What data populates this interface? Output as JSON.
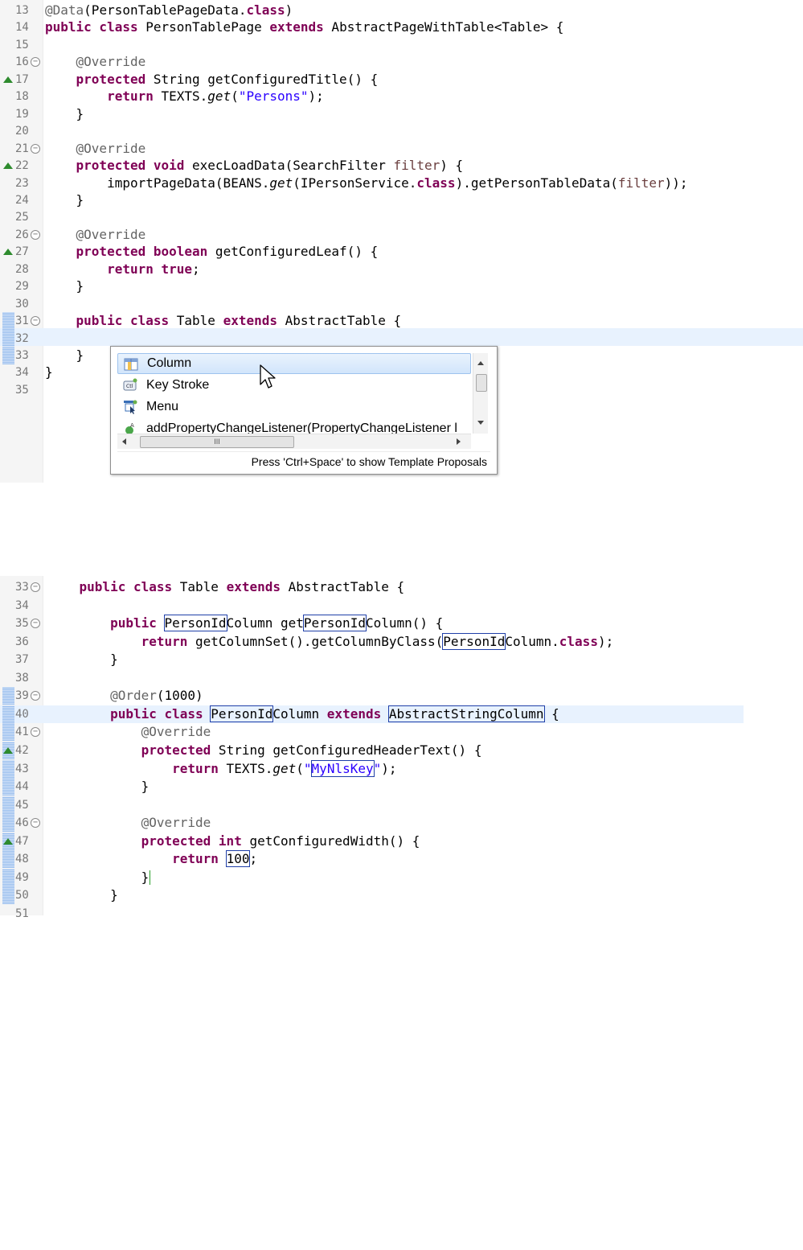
{
  "editor1": {
    "lines": [
      {
        "num": "13",
        "tokens": [
          [
            "an",
            "@Data"
          ],
          [
            "",
            "(PersonTablePageData."
          ],
          [
            "kw",
            "class"
          ],
          [
            "",
            ")"
          ]
        ]
      },
      {
        "num": "14",
        "tokens": [
          [
            "kw",
            "public class"
          ],
          [
            "",
            " PersonTablePage "
          ],
          [
            "kw",
            "extends"
          ],
          [
            "",
            " AbstractPageWithTable<Table> {"
          ]
        ]
      },
      {
        "num": "15",
        "tokens": []
      },
      {
        "num": "16",
        "tokens": [
          [
            "",
            "    "
          ],
          [
            "an",
            "@Override"
          ]
        ]
      },
      {
        "num": "17",
        "tokens": [
          [
            "",
            "    "
          ],
          [
            "kw",
            "protected"
          ],
          [
            "",
            " String getConfiguredTitle() {"
          ]
        ]
      },
      {
        "num": "18",
        "tokens": [
          [
            "",
            "        "
          ],
          [
            "kw",
            "return"
          ],
          [
            "",
            " TEXTS."
          ],
          [
            "it",
            "get"
          ],
          [
            "",
            "("
          ],
          [
            "str",
            "\"Persons\""
          ],
          [
            "",
            ");"
          ]
        ]
      },
      {
        "num": "19",
        "tokens": [
          [
            "",
            "    }"
          ]
        ]
      },
      {
        "num": "20",
        "tokens": []
      },
      {
        "num": "21",
        "tokens": [
          [
            "",
            "    "
          ],
          [
            "an",
            "@Override"
          ]
        ]
      },
      {
        "num": "22",
        "tokens": [
          [
            "",
            "    "
          ],
          [
            "kw",
            "protected void"
          ],
          [
            "",
            " execLoadData(SearchFilter "
          ],
          [
            "param",
            "filter"
          ],
          [
            "",
            ") {"
          ]
        ]
      },
      {
        "num": "23",
        "tokens": [
          [
            "",
            "        importPageData(BEANS."
          ],
          [
            "it",
            "get"
          ],
          [
            "",
            "(IPersonService."
          ],
          [
            "kw",
            "class"
          ],
          [
            "",
            ").getPersonTableData("
          ],
          [
            "param",
            "filter"
          ],
          [
            "",
            "));"
          ]
        ]
      },
      {
        "num": "24",
        "tokens": [
          [
            "",
            "    }"
          ]
        ]
      },
      {
        "num": "25",
        "tokens": []
      },
      {
        "num": "26",
        "tokens": [
          [
            "",
            "    "
          ],
          [
            "an",
            "@Override"
          ]
        ]
      },
      {
        "num": "27",
        "tokens": [
          [
            "",
            "    "
          ],
          [
            "kw",
            "protected boolean"
          ],
          [
            "",
            " getConfiguredLeaf() {"
          ]
        ]
      },
      {
        "num": "28",
        "tokens": [
          [
            "",
            "        "
          ],
          [
            "kw",
            "return true"
          ],
          [
            "",
            ";"
          ]
        ]
      },
      {
        "num": "29",
        "tokens": [
          [
            "",
            "    }"
          ]
        ]
      },
      {
        "num": "30",
        "tokens": []
      },
      {
        "num": "31",
        "tokens": [
          [
            "",
            "    "
          ],
          [
            "kw",
            "public class"
          ],
          [
            "",
            " Table "
          ],
          [
            "kw",
            "extends"
          ],
          [
            "",
            " AbstractTable {"
          ]
        ]
      },
      {
        "num": "32",
        "tokens": []
      },
      {
        "num": "33",
        "tokens": [
          [
            "",
            "    }"
          ]
        ]
      },
      {
        "num": "34",
        "tokens": [
          [
            "",
            "}"
          ]
        ]
      },
      {
        "num": "35",
        "tokens": []
      }
    ]
  },
  "popup": {
    "items": [
      {
        "label": "Column",
        "icon": "column-icon"
      },
      {
        "label": "Key Stroke",
        "icon": "key-stroke-icon"
      },
      {
        "label": "Menu",
        "icon": "menu-icon"
      },
      {
        "label": "addPropertyChangeListener(PropertyChangeListener l",
        "icon": "method-icon"
      }
    ],
    "hscroll_grip": "III",
    "status": "Press 'Ctrl+Space' to show Template Proposals"
  },
  "editor2": {
    "lines": [
      {
        "num": "33",
        "tokens": [
          [
            "",
            "    "
          ],
          [
            "kw",
            "public class"
          ],
          [
            "",
            " Table "
          ],
          [
            "kw",
            "extends"
          ],
          [
            "",
            " AbstractTable {"
          ]
        ]
      },
      {
        "num": "34",
        "tokens": []
      },
      {
        "num": "35",
        "tokens": [
          [
            "",
            "        "
          ],
          [
            "kw",
            "public"
          ],
          [
            "",
            " "
          ],
          [
            "box",
            "PersonId"
          ],
          [
            "",
            "Column get"
          ],
          [
            "box",
            "PersonId"
          ],
          [
            "",
            "Column() {"
          ]
        ]
      },
      {
        "num": "36",
        "tokens": [
          [
            "",
            "            "
          ],
          [
            "kw",
            "return"
          ],
          [
            "",
            " getColumnSet().getColumnByClass("
          ],
          [
            "box",
            "PersonId"
          ],
          [
            "",
            "Column."
          ],
          [
            "kw",
            "class"
          ],
          [
            "",
            ");"
          ]
        ]
      },
      {
        "num": "37",
        "tokens": [
          [
            "",
            "        }"
          ]
        ]
      },
      {
        "num": "38",
        "tokens": []
      },
      {
        "num": "39",
        "tokens": [
          [
            "",
            "        "
          ],
          [
            "an",
            "@Order"
          ],
          [
            "",
            "(1000)"
          ]
        ]
      },
      {
        "num": "40",
        "tokens": [
          [
            "",
            "        "
          ],
          [
            "kw",
            "public class"
          ],
          [
            "",
            " "
          ],
          [
            "box",
            "PersonId"
          ],
          [
            "",
            "Column "
          ],
          [
            "kw",
            "extends"
          ],
          [
            "",
            " "
          ],
          [
            "box",
            "AbstractStringColumn"
          ],
          [
            "",
            " {"
          ]
        ]
      },
      {
        "num": "41",
        "tokens": [
          [
            "",
            "            "
          ],
          [
            "an",
            "@Override"
          ]
        ]
      },
      {
        "num": "42",
        "tokens": [
          [
            "",
            "            "
          ],
          [
            "kw",
            "protected"
          ],
          [
            "",
            " String getConfiguredHeaderText() {"
          ]
        ]
      },
      {
        "num": "43",
        "tokens": [
          [
            "",
            "                "
          ],
          [
            "kw",
            "return"
          ],
          [
            "",
            " TEXTS."
          ],
          [
            "it",
            "get"
          ],
          [
            "",
            "("
          ],
          [
            "str",
            "\""
          ],
          [
            "strbox",
            "MyNlsKey"
          ],
          [
            "str",
            "\""
          ],
          [
            "",
            ");"
          ]
        ]
      },
      {
        "num": "44",
        "tokens": [
          [
            "",
            "            }"
          ]
        ]
      },
      {
        "num": "45",
        "tokens": []
      },
      {
        "num": "46",
        "tokens": [
          [
            "",
            "            "
          ],
          [
            "an",
            "@Override"
          ]
        ]
      },
      {
        "num": "47",
        "tokens": [
          [
            "",
            "            "
          ],
          [
            "kw",
            "protected int"
          ],
          [
            "",
            " getConfiguredWidth() {"
          ]
        ]
      },
      {
        "num": "48",
        "tokens": [
          [
            "",
            "                "
          ],
          [
            "kw",
            "return"
          ],
          [
            "",
            " "
          ],
          [
            "box",
            "100"
          ],
          [
            "",
            ";"
          ]
        ]
      },
      {
        "num": "49",
        "tokens": [
          [
            "",
            "            }"
          ],
          [
            "caret",
            ""
          ]
        ]
      },
      {
        "num": "50",
        "tokens": [
          [
            "",
            "        }"
          ]
        ]
      },
      {
        "num": "51",
        "tokens": []
      }
    ]
  }
}
